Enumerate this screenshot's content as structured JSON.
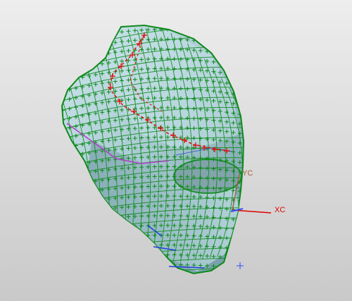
{
  "viewport": {
    "background_top": "#ededed",
    "background_bottom": "#c9c9c9"
  },
  "model": {
    "surface_color": "#a8c9d2",
    "surface_shadow": "#6e97a2",
    "mesh_color": "#0d8a1a",
    "feature_curve_color": "#e01010",
    "edge_curve_color": "#b040c8",
    "secondary_curve_color": "#2040d8"
  },
  "wcs": {
    "x_label": "XC",
    "y_label": "YC",
    "x_color": "#e00000",
    "y_color": "#a06040",
    "origin_color": "#3050ff"
  }
}
